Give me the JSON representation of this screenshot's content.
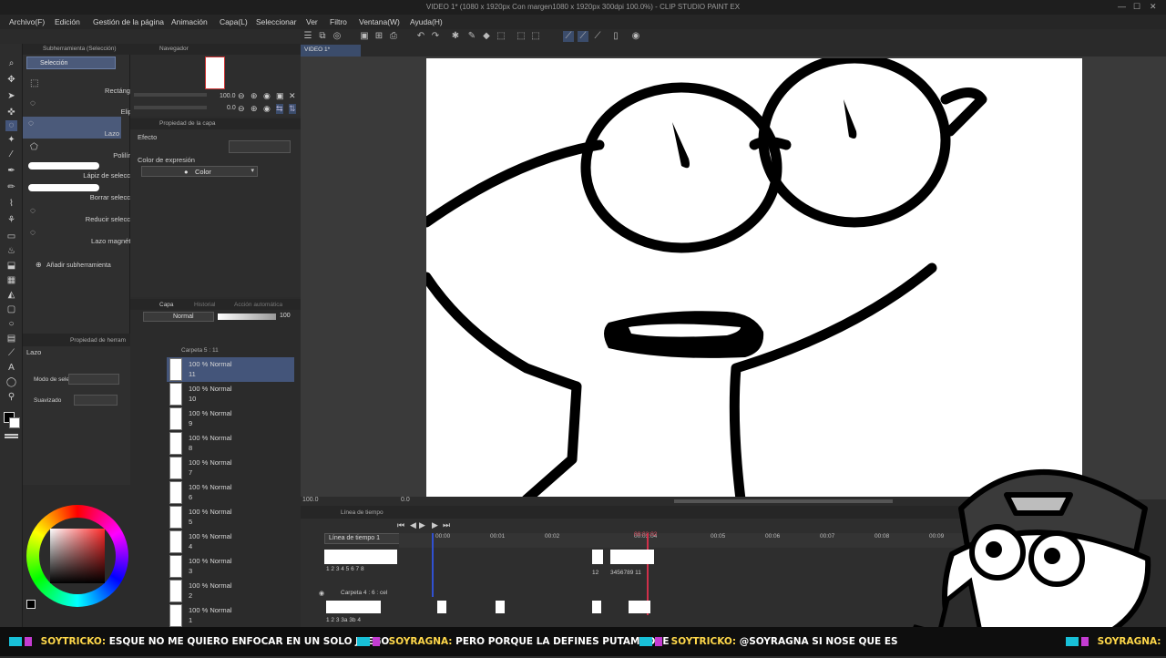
{
  "window": {
    "title": "VIDEO 1* (1080 x 1920px Con margen1080 x 1920px 300dpi 100.0%) - CLIP STUDIO PAINT EX"
  },
  "menu": [
    "Archivo(F)",
    "Edición",
    "Gestión de la página",
    "Animación",
    "Capa(L)",
    "Seleccionar",
    "Ver",
    "Filtro",
    "Ventana(W)",
    "Ayuda(H)"
  ],
  "subtool_panel": {
    "title": "Subherramienta (Selección)",
    "group": "Selección",
    "items": [
      "Rectángulo",
      "Elipse",
      "Lazo",
      "Polilínea",
      "Lápiz de selección",
      "Borrar selección",
      "Reducir selección",
      "Lazo magnético"
    ],
    "add_label": "Añadir subherramienta"
  },
  "navigator": {
    "tab": "Navegador",
    "zoom": "100.0",
    "rotation": "0.0"
  },
  "layer_property": {
    "tab": "Propiedad de la capa",
    "effect_label": "Efecto",
    "expression_label": "Color de expresión",
    "expression_value": "Color"
  },
  "tool_property": {
    "tab": "Propiedad de herram",
    "tool_name": "Lazo",
    "mode_label": "Modo de sele",
    "smooth_label": "Suavizado"
  },
  "layer_panel": {
    "tabs": [
      "Capa",
      "Historial",
      "Acción automática"
    ],
    "blend_mode": "Normal",
    "opacity": "100",
    "folder": "Carpeta 5 : 11",
    "layers": [
      {
        "mode": "100 % Normal",
        "name": "11"
      },
      {
        "mode": "100 % Normal",
        "name": "10"
      },
      {
        "mode": "100 % Normal",
        "name": "9"
      },
      {
        "mode": "100 % Normal",
        "name": "8"
      },
      {
        "mode": "100 % Normal",
        "name": "7"
      },
      {
        "mode": "100 % Normal",
        "name": "6"
      },
      {
        "mode": "100 % Normal",
        "name": "5"
      },
      {
        "mode": "100 % Normal",
        "name": "4"
      },
      {
        "mode": "100 % Normal",
        "name": "3"
      },
      {
        "mode": "100 % Normal",
        "name": "2"
      },
      {
        "mode": "100 % Normal",
        "name": "1"
      }
    ]
  },
  "canvas": {
    "tab": "VIDEO 1*",
    "zoom": "100.0",
    "angle": "0.0"
  },
  "timeline": {
    "tab": "Línea de tiempo",
    "select": "Línea de tiempo 1",
    "current_time": "00:03:02",
    "ruler": [
      "00:00",
      "00:01",
      "00:02",
      "00:03:04",
      "00:05",
      "00:06",
      "00:07",
      "00:08",
      "00:09"
    ],
    "track_folder": "Carpeta 4 : 6 : cel",
    "row1_nums": "1 2 3 4 5 6 7 8",
    "row1b_nums": "12",
    "row1c_nums": "3456789 11",
    "row2_nums": "1 2 3 3a 3b 4"
  },
  "chat": [
    {
      "user": "SOYTRICKO:",
      "text": "ESQUE NO ME QUIERO ENFOCAR EN UN SOLO JUEGO"
    },
    {
      "user": "SOYRAGNA:",
      "text": "PERO PORQUE LA DEFINES PUTAMADRE"
    },
    {
      "user": "SOYTRICKO:",
      "text": "@SOYRAGNA SI NOSE QUE ES"
    },
    {
      "user": "SOYRAGNA:",
      "text": ""
    }
  ],
  "colors": {
    "accent": "#4b6fb3",
    "bg": "#2b2b2b",
    "playhead": "#d0304a",
    "chat_user": "#ffd84a"
  }
}
